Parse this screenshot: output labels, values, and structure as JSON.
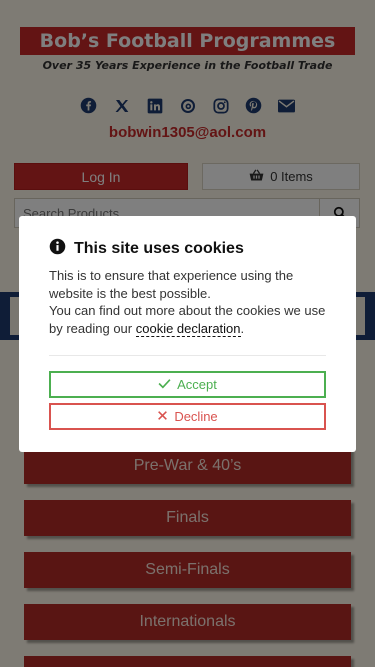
{
  "header": {
    "title": "Bob’s Football Programmes",
    "tagline": "Over 35 Years Experience in the Football Trade",
    "email": "bobwin1305@aol.com",
    "social_icons": [
      "facebook-icon",
      "x-icon",
      "linkedin-icon",
      "threads-icon",
      "instagram-icon",
      "pinterest-icon",
      "envelope-icon"
    ]
  },
  "account": {
    "login_label": "Log In",
    "basket_label": "0 Items"
  },
  "search": {
    "placeholder": "Search Products..."
  },
  "categories": [
    {
      "label": "Pre-War & 40’s"
    },
    {
      "label": "Finals"
    },
    {
      "label": "Semi-Finals"
    },
    {
      "label": "Internationals"
    }
  ],
  "cookie_dialog": {
    "title": "This site uses cookies",
    "line1": "This is to ensure that experience using the website is the best possible.",
    "line2_prefix": "You can find out more about the cookies we use by reading our ",
    "link_text": "cookie declaration",
    "line2_suffix": ".",
    "accept_label": "Accept",
    "decline_label": "Decline"
  },
  "colors": {
    "brand_red": "#c62828",
    "background": "#fcf6e8",
    "accept_green": "#4caf50",
    "decline_red": "#d9534f"
  }
}
